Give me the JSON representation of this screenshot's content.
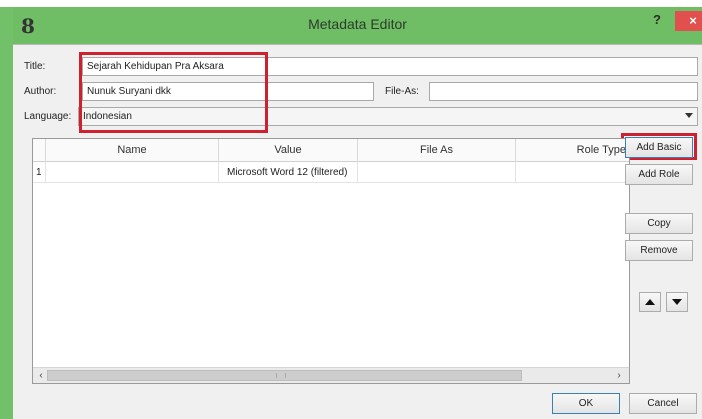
{
  "window": {
    "title": "Metadata Editor",
    "app_icon_glyph": "8",
    "help_glyph": "?",
    "close_glyph": "×"
  },
  "form": {
    "title_label": "Title:",
    "title_value": "Sejarah Kehidupan Pra Aksara",
    "author_label": "Author:",
    "author_value": "Nunuk Suryani dkk",
    "file_as_label": "File-As:",
    "file_as_value": "",
    "language_label": "Language:",
    "language_value": "Indonesian"
  },
  "table": {
    "headers": [
      "Name",
      "Value",
      "File As",
      "Role Type"
    ],
    "rows": [
      {
        "index": "1",
        "name": "",
        "value": "Microsoft Word 12 (filtered)",
        "file_as": "",
        "role_type": ""
      }
    ],
    "scroll_left_glyph": "‹",
    "scroll_right_glyph": "›"
  },
  "buttons": {
    "add_basic": "Add Basic",
    "add_role": "Add Role",
    "copy": "Copy",
    "remove": "Remove",
    "ok": "OK",
    "cancel": "Cancel"
  },
  "icons": {
    "move_up": "triangle-up-icon",
    "move_down": "triangle-down-icon",
    "combo_arrow": "chevron-down-icon"
  },
  "colors": {
    "title_bar": "#6fbe66",
    "close_button": "#e14f4f",
    "highlight_box": "#cf2030",
    "dialog_background": "#f0f0f0"
  }
}
